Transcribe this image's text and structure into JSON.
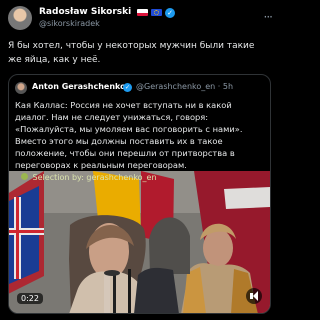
{
  "post": {
    "author_name": "Radosław Sikorski",
    "handle": "@sikorskiradek",
    "text": "Я бы хотел, чтобы у некоторых мужчин были такие же яйца, как у неё.",
    "more_icon": "more-horizontal-icon",
    "verified_icon": "verified-badge-icon",
    "flags": [
      "poland-flag-icon",
      "eu-flag-icon"
    ]
  },
  "quote": {
    "author_name": "Anton Gerashchenko",
    "handle": "@Gerashchenko_en · 5h",
    "text": "Кая Каллас: Россия не хочет вступать ни в какой диалог. Нам не следует унижаться, говоря: «Пожалуйста, мы умоляем вас поговорить с нами». Вместо этого мы должны поставить их в такое положение, чтобы они перешли от притворства в переговорах к реальным переговорам.",
    "video": {
      "caption": "Selection by: gerashchenko_en",
      "duration": "0:22",
      "mute_icon": "volume-mute-icon"
    }
  },
  "colors": {
    "background": "#000000",
    "text": "#e7e9ea",
    "muted": "#8b98a5",
    "verified": "#1d9bf0"
  }
}
